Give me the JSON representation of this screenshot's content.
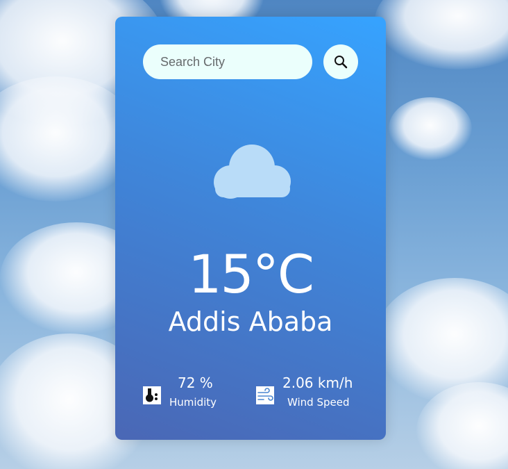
{
  "search": {
    "placeholder": "Search City",
    "value": ""
  },
  "weather": {
    "condition_icon": "cloud-icon",
    "temperature": "15°C",
    "city": "Addis Ababa",
    "humidity": {
      "value": "72 %",
      "label": "Humidity",
      "icon": "humidity-icon"
    },
    "wind": {
      "value": "2.06 km/h",
      "label": "Wind Speed",
      "icon": "wind-icon"
    }
  },
  "colors": {
    "card_top": "#36a3ff",
    "card_bottom": "#4a67b5",
    "input_bg": "#ebfffc",
    "cloud_icon": "#b9dcf8",
    "text": "#ffffff"
  }
}
